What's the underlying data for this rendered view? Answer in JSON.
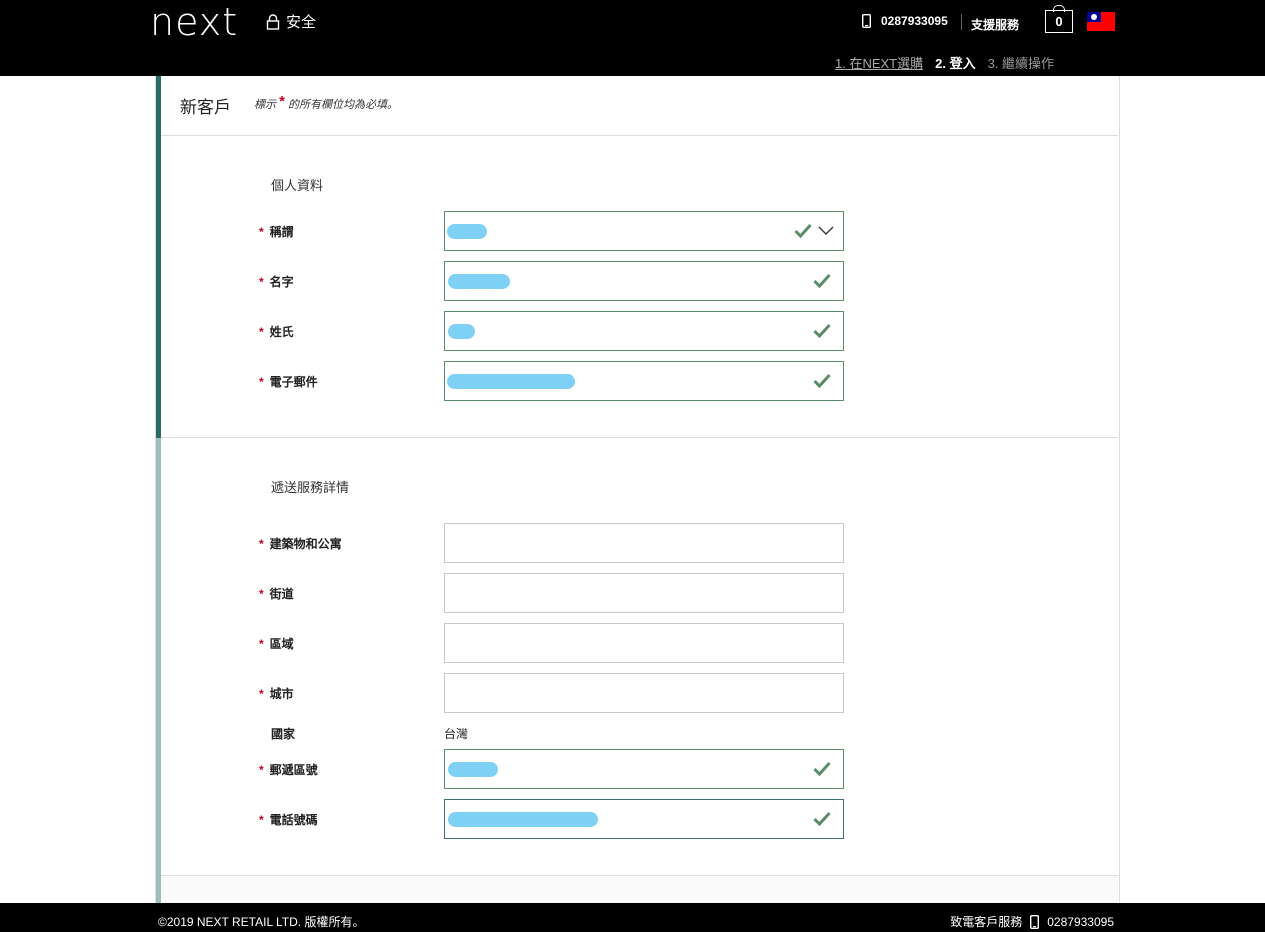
{
  "header": {
    "logo": "next",
    "secure_label": "安全",
    "phone": "0287933095",
    "support_label": "支援服務",
    "bag_count": "0",
    "steps": [
      {
        "label": "1. 在NEXT選購"
      },
      {
        "label": "2. 登入"
      },
      {
        "label": "3. 繼續操作"
      }
    ]
  },
  "form": {
    "title": "新客戶",
    "required_note_prefix": "標示",
    "required_note_star": "*",
    "required_note_suffix": "的所有欄位均為必填。",
    "personal": {
      "section_title": "個人資料",
      "fields": [
        {
          "label": "稱謂",
          "required": true,
          "type": "select",
          "valid": true
        },
        {
          "label": "名字",
          "required": true,
          "type": "text",
          "valid": true
        },
        {
          "label": "姓氏",
          "required": true,
          "type": "text",
          "valid": true
        },
        {
          "label": "電子郵件",
          "required": true,
          "type": "email",
          "valid": true
        }
      ]
    },
    "delivery": {
      "section_title": "遞送服務詳情",
      "fields": [
        {
          "label": "建築物和公寓",
          "required": true,
          "value": ""
        },
        {
          "label": "街道",
          "required": true,
          "value": ""
        },
        {
          "label": "區域",
          "required": true,
          "value": ""
        },
        {
          "label": "城市",
          "required": true,
          "value": ""
        }
      ],
      "country_label": "國家",
      "country_value": "台灣",
      "postcode_label": "郵遞區號",
      "phone_label": "電話號碼"
    }
  },
  "footer": {
    "copyright": "©2019 NEXT RETAIL LTD. 版權所有。",
    "call_label": "致電客戶服務",
    "phone": "0287933095"
  },
  "colors": {
    "valid_check": "#5a8c69",
    "required_star": "#c0001e",
    "accent_bar": "#2b6b66",
    "redaction": "#7fd0f5"
  }
}
